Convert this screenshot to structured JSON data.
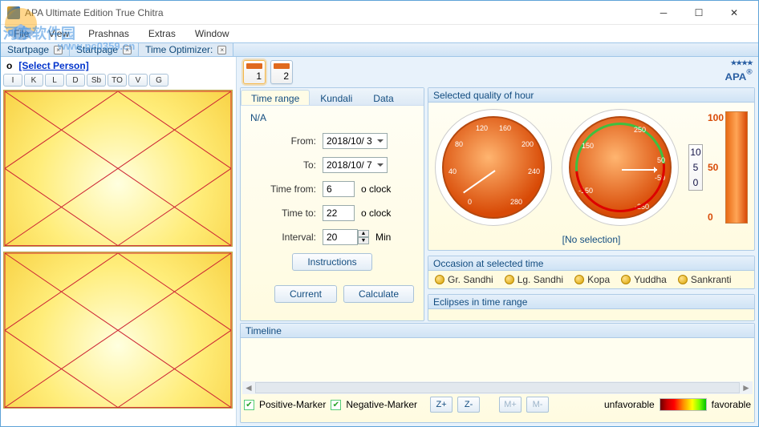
{
  "window": {
    "title": "APA Ultimate Edition  True Chitra"
  },
  "watermark": {
    "text": "河东软件园",
    "url": "www.pc0359.cn"
  },
  "menu": {
    "items": [
      "File",
      "View",
      "Prashnas",
      "Extras",
      "Window"
    ]
  },
  "toolbar_tabs": [
    {
      "label": "Startpage"
    },
    {
      "label": "Startpage"
    },
    {
      "label": "Time Optimizer:"
    }
  ],
  "sidebar": {
    "person_link": "[Select Person]",
    "bullet": "o",
    "pills": [
      "I",
      "K",
      "L",
      "D",
      "Sb",
      "TO",
      "V",
      "G"
    ]
  },
  "pages": {
    "p1": "1",
    "p2": "2"
  },
  "logo": "APA",
  "time_panel": {
    "tabs": [
      "Time range",
      "Kundali",
      "Data"
    ],
    "na": "N/A",
    "from_label": "From:",
    "from_value": "2018/10/ 3",
    "to_label": "To:",
    "to_value": "2018/10/ 7",
    "time_from_label": "Time from:",
    "time_from_value": "6",
    "time_to_label": "Time to:",
    "time_to_value": "22",
    "oclock": "o clock",
    "interval_label": "Interval:",
    "interval_value": "20",
    "min": "Min",
    "instructions": "Instructions",
    "current": "Current",
    "calculate": "Calculate"
  },
  "quality_panel": {
    "title": "Selected quality of hour",
    "gauge1_ticks": {
      "t0": "0",
      "t40": "40",
      "t80": "80",
      "t120": "120",
      "t160": "160",
      "t200": "200",
      "t240": "240",
      "t280": "280"
    },
    "gauge2_ticks": {
      "t250": "250",
      "t150": "150",
      "t50": "50",
      "tm50": "-50",
      "tm150": "-150",
      "tm250": "-250"
    },
    "mini": {
      "top": "10",
      "mid": "5",
      "bot": "0"
    },
    "bar": {
      "top": "100",
      "mid": "50",
      "bot": "0"
    },
    "nosel": "[No selection]"
  },
  "occasion": {
    "title": "Occasion at selected time",
    "items": [
      "Gr. Sandhi",
      "Lg. Sandhi",
      "Kopa",
      "Yuddha",
      "Sankranti"
    ]
  },
  "eclipses": {
    "title": "Eclipses in time range"
  },
  "timeline": {
    "title": "Timeline",
    "pos_marker": "Positive-Marker",
    "neg_marker": "Negative-Marker",
    "zp": "Z+",
    "zm": "Z-",
    "mp": "M+",
    "mm": "M-",
    "unfav": "unfavorable",
    "fav": "favorable"
  }
}
